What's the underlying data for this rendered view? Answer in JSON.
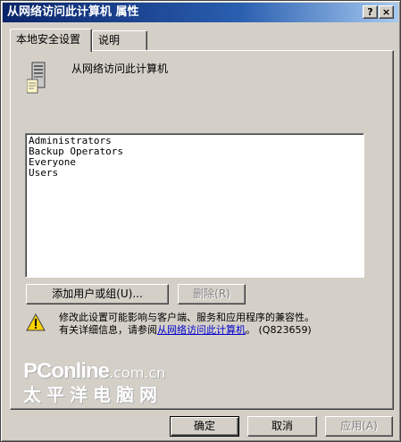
{
  "window": {
    "title": "从网络访问此计算机 属性",
    "help_glyph": "?",
    "close_glyph": "×"
  },
  "tabs": [
    {
      "label": "本地安全设置",
      "active": true
    },
    {
      "label": "说明",
      "active": false
    }
  ],
  "policy": {
    "icon": "computer-tower-icon",
    "name": "从网络访问此计算机"
  },
  "list": {
    "items": [
      "Administrators",
      "Backup Operators",
      "Everyone",
      "Users"
    ]
  },
  "buttons": {
    "add": "添加用户或组(U)...",
    "remove": "删除(R)",
    "ok": "确定",
    "cancel": "取消",
    "apply": "应用(A)"
  },
  "warning": {
    "icon": "warning-triangle-icon",
    "line1": "修改此设置可能影响与客户端、服务和应用程序的兼容性。",
    "line2_prefix": "有关详细信息，请参阅",
    "link": "从网络访问此计算机",
    "line2_suffix": "。 (Q823659)"
  },
  "watermark": {
    "brand": "PConline",
    "domain": ".com.cn",
    "chinese": "太平洋电脑网"
  },
  "colors": {
    "title_start": "#0a246a",
    "title_end": "#a6caf0",
    "face": "#d4d0c8",
    "link": "#0000cc"
  }
}
